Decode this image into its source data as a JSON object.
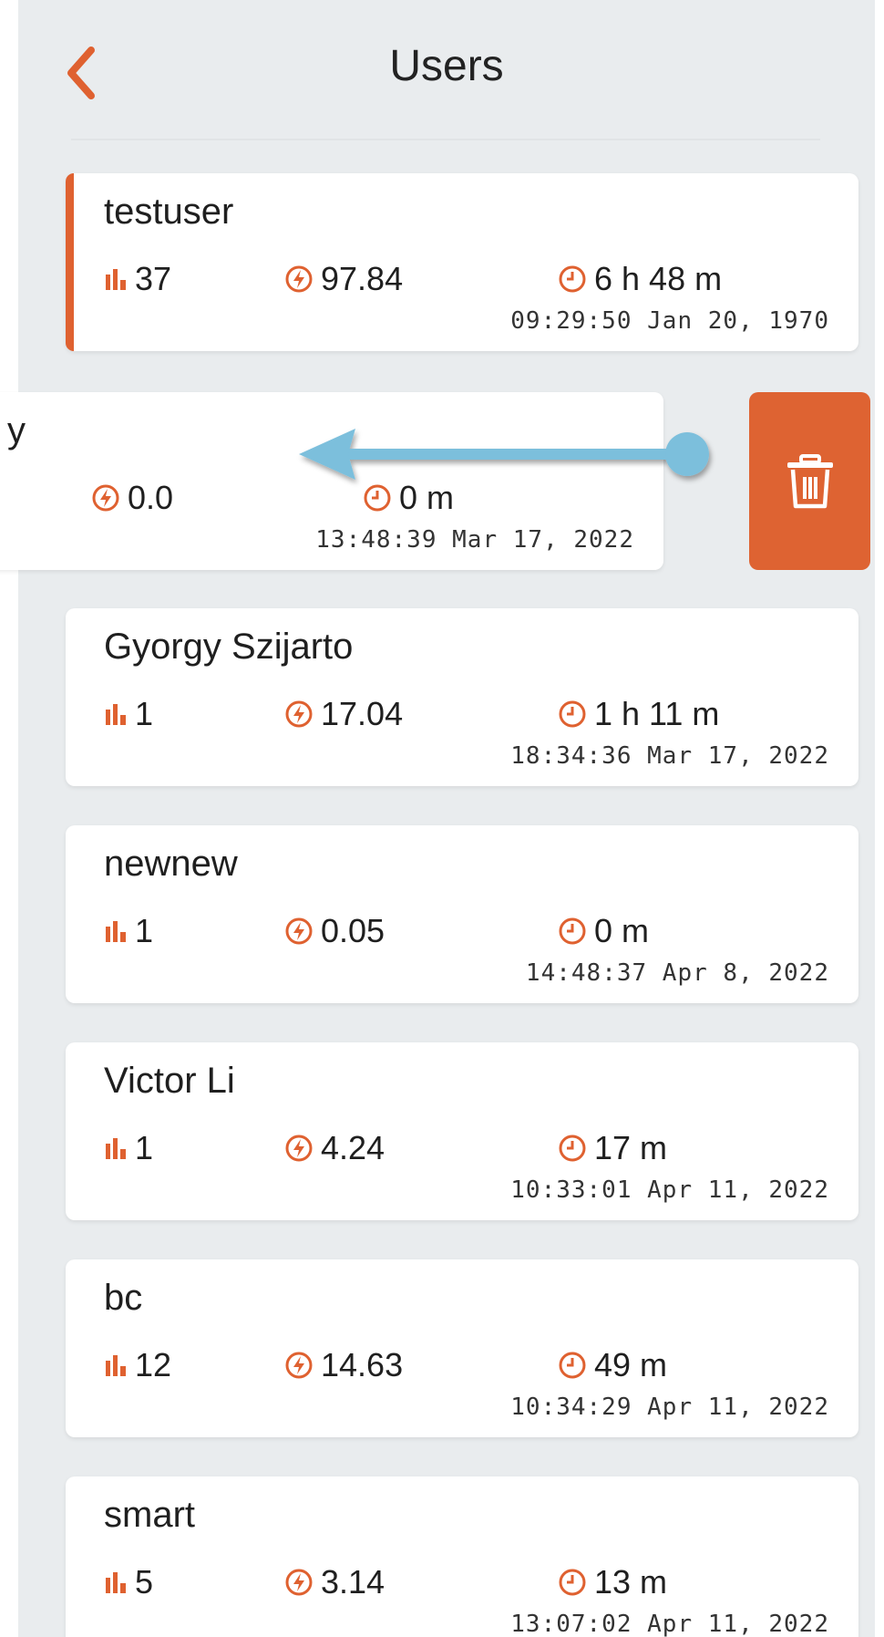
{
  "header": {
    "title": "Users"
  },
  "colors": {
    "accent": "#df6130",
    "background": "#e9ecee",
    "card": "#ffffff",
    "arrow": "#7cbfdc"
  },
  "icons": {
    "back": "chevron-left-icon",
    "sessions": "bar-chart-icon",
    "energy": "lightning-circle-icon",
    "duration": "clock-icon",
    "delete": "trash-icon"
  },
  "swiped_card": {
    "name": "y",
    "energy": "0.0",
    "duration": "0 m",
    "timestamp": "13:48:39 Mar 17, 2022"
  },
  "delete_action": {
    "icon": "trash-icon"
  },
  "users": [
    {
      "name": "testuser",
      "sessions": "37",
      "energy": "97.84",
      "duration": "6 h 48 m",
      "timestamp": "09:29:50 Jan 20, 1970",
      "selected": true
    },
    {
      "name": "Gyorgy Szijarto",
      "sessions": "1",
      "energy": "17.04",
      "duration": "1 h 11 m",
      "timestamp": "18:34:36 Mar 17, 2022"
    },
    {
      "name": "newnew",
      "sessions": "1",
      "energy": "0.05",
      "duration": "0 m",
      "timestamp": "14:48:37 Apr 8, 2022"
    },
    {
      "name": "Victor Li",
      "sessions": "1",
      "energy": "4.24",
      "duration": "17 m",
      "timestamp": "10:33:01 Apr 11, 2022"
    },
    {
      "name": "bc",
      "sessions": "12",
      "energy": "14.63",
      "duration": "49 m",
      "timestamp": "10:34:29 Apr 11, 2022"
    },
    {
      "name": "smart",
      "sessions": "5",
      "energy": "3.14",
      "duration": "13 m",
      "timestamp": "13:07:02 Apr 11, 2022"
    }
  ]
}
